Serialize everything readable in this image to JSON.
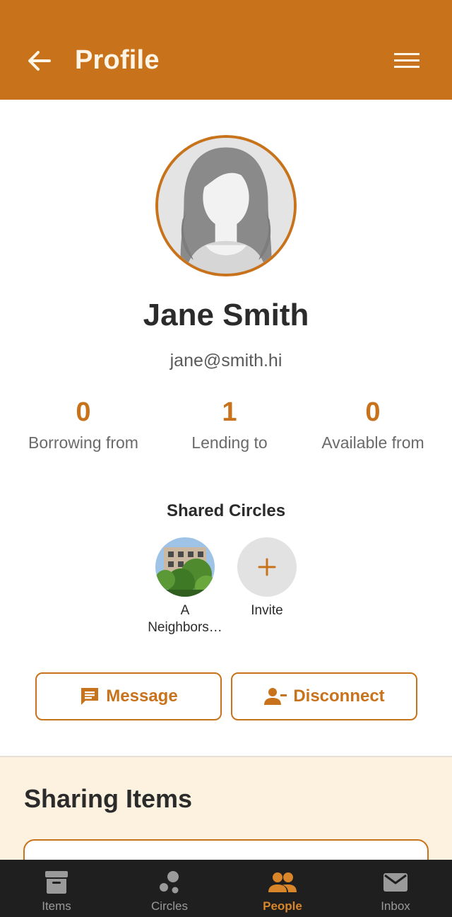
{
  "appbar": {
    "title": "Profile",
    "back_icon": "arrow-left-icon",
    "menu_icon": "hamburger-menu-icon"
  },
  "profile": {
    "name": "Jane Smith",
    "email": "jane@smith.hi"
  },
  "stats": [
    {
      "value": "0",
      "label": "Borrowing from"
    },
    {
      "value": "1",
      "label": "Lending to"
    },
    {
      "value": "0",
      "label": "Available from"
    }
  ],
  "shared_circles": {
    "title": "Shared Circles",
    "items": [
      {
        "label": "A Neighbors…"
      },
      {
        "label": "Invite"
      }
    ]
  },
  "actions": {
    "message": "Message",
    "disconnect": "Disconnect"
  },
  "sharing": {
    "heading": "Sharing Items"
  },
  "bottom_nav": [
    {
      "label": "Items",
      "icon": "archive-box-icon",
      "active": false
    },
    {
      "label": "Circles",
      "icon": "circles-icon",
      "active": false
    },
    {
      "label": "People",
      "icon": "people-icon",
      "active": true
    },
    {
      "label": "Inbox",
      "icon": "mail-icon",
      "active": false
    }
  ],
  "colors": {
    "accent": "#c8731b",
    "sharing_bg": "#fdf2df",
    "nav_bg": "#1f1f1f"
  }
}
